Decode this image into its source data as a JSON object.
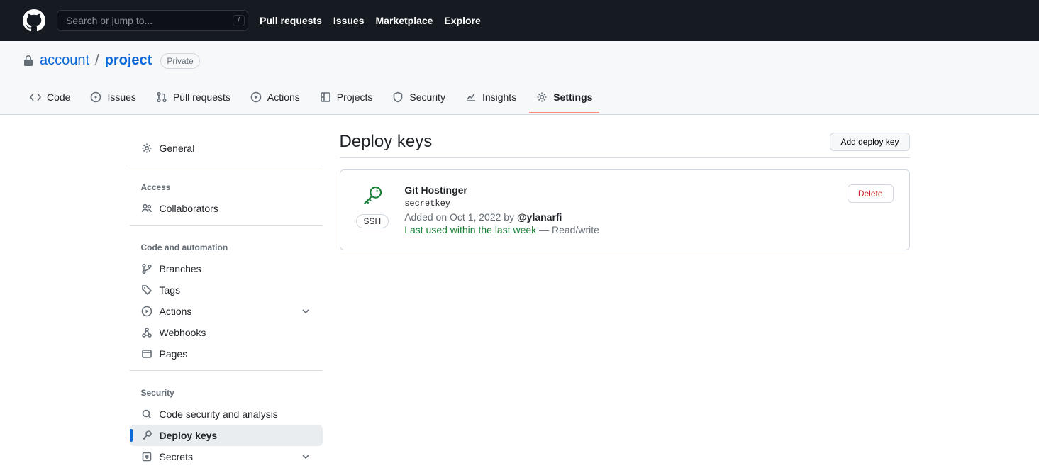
{
  "header": {
    "search_placeholder": "Search or jump to...",
    "search_shortcut": "/",
    "nav": [
      "Pull requests",
      "Issues",
      "Marketplace",
      "Explore"
    ]
  },
  "repo": {
    "owner": "account",
    "name": "project",
    "visibility": "Private",
    "tabs": [
      {
        "id": "code",
        "label": "Code"
      },
      {
        "id": "issues",
        "label": "Issues"
      },
      {
        "id": "pull-requests",
        "label": "Pull requests"
      },
      {
        "id": "actions",
        "label": "Actions"
      },
      {
        "id": "projects",
        "label": "Projects"
      },
      {
        "id": "security",
        "label": "Security"
      },
      {
        "id": "insights",
        "label": "Insights"
      },
      {
        "id": "settings",
        "label": "Settings",
        "active": true
      }
    ]
  },
  "sidebar": {
    "sections": [
      {
        "heading": null,
        "items": [
          {
            "id": "general",
            "label": "General"
          }
        ]
      },
      {
        "heading": "Access",
        "items": [
          {
            "id": "collaborators",
            "label": "Collaborators"
          }
        ]
      },
      {
        "heading": "Code and automation",
        "items": [
          {
            "id": "branches",
            "label": "Branches"
          },
          {
            "id": "tags",
            "label": "Tags"
          },
          {
            "id": "actions-side",
            "label": "Actions",
            "expandable": true
          },
          {
            "id": "webhooks",
            "label": "Webhooks"
          },
          {
            "id": "pages",
            "label": "Pages"
          }
        ]
      },
      {
        "heading": "Security",
        "items": [
          {
            "id": "code-security",
            "label": "Code security and analysis"
          },
          {
            "id": "deploy-keys",
            "label": "Deploy keys",
            "active": true
          },
          {
            "id": "secrets",
            "label": "Secrets",
            "expandable": true
          }
        ]
      }
    ]
  },
  "page": {
    "title": "Deploy keys",
    "add_button": "Add deploy key",
    "key": {
      "title": "Git Hostinger",
      "secret": "secretkey",
      "added_prefix": "Added on ",
      "added_date": "Oct 1, 2022",
      "added_by_prefix": " by ",
      "added_by": "@ylanarfi",
      "last_used": "Last used within the last week",
      "access_sep": " — ",
      "access": "Read/write",
      "type_badge": "SSH",
      "delete": "Delete"
    }
  }
}
